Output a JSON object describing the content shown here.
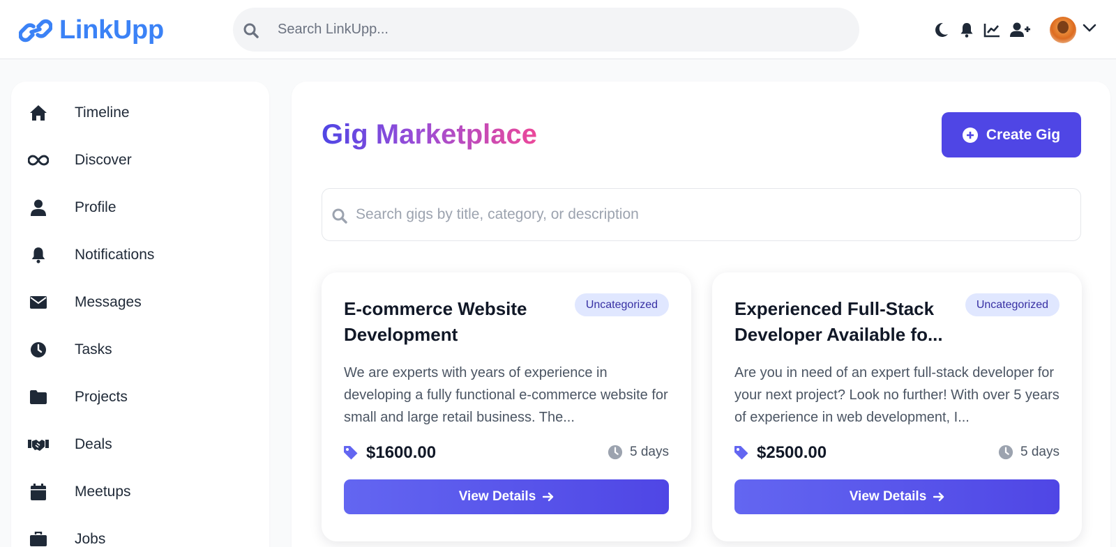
{
  "app": {
    "name": "LinkUpp",
    "brand_color": "#3b82f6",
    "accent_color": "#4f46e5"
  },
  "header": {
    "search_placeholder": "Search LinkUpp...",
    "icons": [
      "moon-icon",
      "bell-icon",
      "chart-line-icon",
      "user-plus-icon"
    ]
  },
  "sidebar": {
    "items": [
      {
        "label": "Timeline",
        "icon": "home-icon"
      },
      {
        "label": "Discover",
        "icon": "infinity-icon"
      },
      {
        "label": "Profile",
        "icon": "user-icon"
      },
      {
        "label": "Notifications",
        "icon": "bell-icon"
      },
      {
        "label": "Messages",
        "icon": "envelope-icon"
      },
      {
        "label": "Tasks",
        "icon": "clock-icon"
      },
      {
        "label": "Projects",
        "icon": "folder-icon"
      },
      {
        "label": "Deals",
        "icon": "handshake-icon"
      },
      {
        "label": "Meetups",
        "icon": "calendar-icon"
      },
      {
        "label": "Jobs",
        "icon": "briefcase-icon"
      }
    ]
  },
  "main": {
    "title": "Gig Marketplace",
    "create_label": "Create Gig",
    "search_placeholder": "Search gigs by title, category, or description",
    "gigs": [
      {
        "title": "E-commerce Website Development",
        "category": "Uncategorized",
        "description": "We are experts with years of experience in developing a fully functional e-commerce website for small and large retail business. The...",
        "price": "$1600.00",
        "duration": "5 days",
        "button_label": "View Details"
      },
      {
        "title": "Experienced Full-Stack Developer Available fo...",
        "category": "Uncategorized",
        "description": "Are you in need of an expert full-stack developer for your next project? Look no further! With over 5 years of experience in web development, I...",
        "price": "$2500.00",
        "duration": "5 days",
        "button_label": "View Details"
      }
    ]
  }
}
